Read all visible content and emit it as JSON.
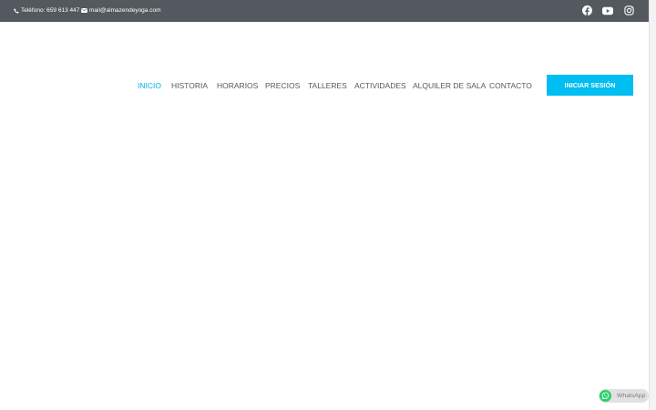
{
  "topbar": {
    "phone": "Teléfono: 659 613 447",
    "email": "mail@almazendeyoga.com",
    "social": [
      "facebook-icon",
      "youtube-icon",
      "instagram-icon"
    ]
  },
  "nav": {
    "items": [
      {
        "label": "INICIO",
        "active": true
      },
      {
        "label": "HISTORIA",
        "active": false
      },
      {
        "label": "HORARIOS",
        "active": false
      },
      {
        "label": "PRECIOS",
        "active": false
      },
      {
        "label": "TALLERES",
        "active": false
      },
      {
        "label": "ACTIVIDADES",
        "active": false
      },
      {
        "label": "ALQUILER DE SALA",
        "active": false
      },
      {
        "label": "CONTACTO",
        "active": false
      }
    ],
    "login_label": "INICIAR SESIÓN"
  },
  "whatsapp": {
    "label": "WhatsApp"
  },
  "colors": {
    "topbar_bg": "#54595f",
    "accent": "#00b5e6",
    "button_bg": "#00bdf2",
    "nav_text": "#54595f",
    "whatsapp_green": "#25d366"
  }
}
